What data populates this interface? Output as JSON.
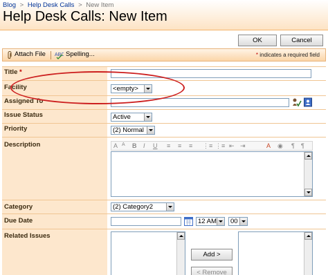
{
  "breadcrumb": {
    "items": [
      "Blog",
      "Help Desk Calls",
      "New Item"
    ],
    "separator": ">"
  },
  "page": {
    "title": "Help Desk Calls: New Item"
  },
  "actions": {
    "ok_label": "OK",
    "cancel_label": "Cancel"
  },
  "toolbar": {
    "attach_label": "Attach File",
    "spelling_label": "Spelling...",
    "required_star": "*",
    "required_note": "indicates a required field"
  },
  "fields": {
    "title": {
      "label": "Title",
      "required_star": "*",
      "value": ""
    },
    "facility": {
      "label": "Facility",
      "value": "<empty>"
    },
    "assigned_to": {
      "label": "Assigned To",
      "value": ""
    },
    "issue_status": {
      "label": "Issue Status",
      "value": "Active"
    },
    "priority": {
      "label": "Priority",
      "value": "(2) Normal"
    },
    "description": {
      "label": "Description",
      "rte_buttons": [
        "A",
        "A",
        "B",
        "I",
        "U",
        "≡",
        "≡",
        "≡",
        "⋮≡",
        "⋮≡",
        "⇤",
        "⇥",
        "A",
        "◉",
        "¶",
        "¶"
      ]
    },
    "category": {
      "label": "Category",
      "value": "(2) Category2"
    },
    "due_date": {
      "label": "Due Date",
      "value": "",
      "hour": "12 AM",
      "minute": "00"
    },
    "related_issues": {
      "label": "Related Issues",
      "add_label": "Add >",
      "remove_label": "< Remove"
    }
  },
  "colors": {
    "accent_orange": "#f4b46c",
    "label_bg": "#fde7cd",
    "annotation_red": "#cc1f1f",
    "link_blue": "#003399"
  },
  "icons": [
    "paperclip-icon",
    "spelling-check-icon",
    "check-names-icon",
    "address-book-icon",
    "calendar-icon"
  ]
}
